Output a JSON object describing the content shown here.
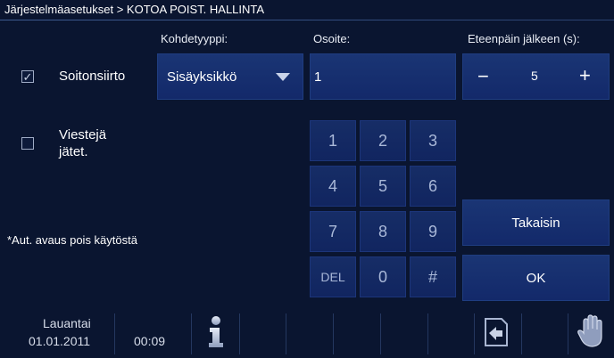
{
  "breadcrumb": "Järjestelmäasetukset > KOTOA POIST. HALLINTA",
  "columns": {
    "target_type": "Kohdetyyppi:",
    "address": "Osoite:",
    "forward_after": "Eteenpäin jälkeen (s):"
  },
  "options": {
    "call_forward": {
      "label": "Soitonsiirto",
      "checked": true,
      "mark": "✓"
    },
    "leave_message": {
      "label_line1": "Viestejä",
      "label_line2": "jätet.",
      "checked": false
    }
  },
  "target_type_value": "Sisäyksikkö",
  "address_value": "1",
  "stepper": {
    "minus": "−",
    "value": "5",
    "plus": "+"
  },
  "keypad": [
    "1",
    "2",
    "3",
    "4",
    "5",
    "6",
    "7",
    "8",
    "9",
    "DEL",
    "0",
    "#"
  ],
  "note": "*Aut. avaus pois käytöstä",
  "buttons": {
    "back": "Takaisin",
    "ok": "OK"
  },
  "status": {
    "day": "Lauantai",
    "date": "01.01.2011",
    "time": "00:09"
  }
}
